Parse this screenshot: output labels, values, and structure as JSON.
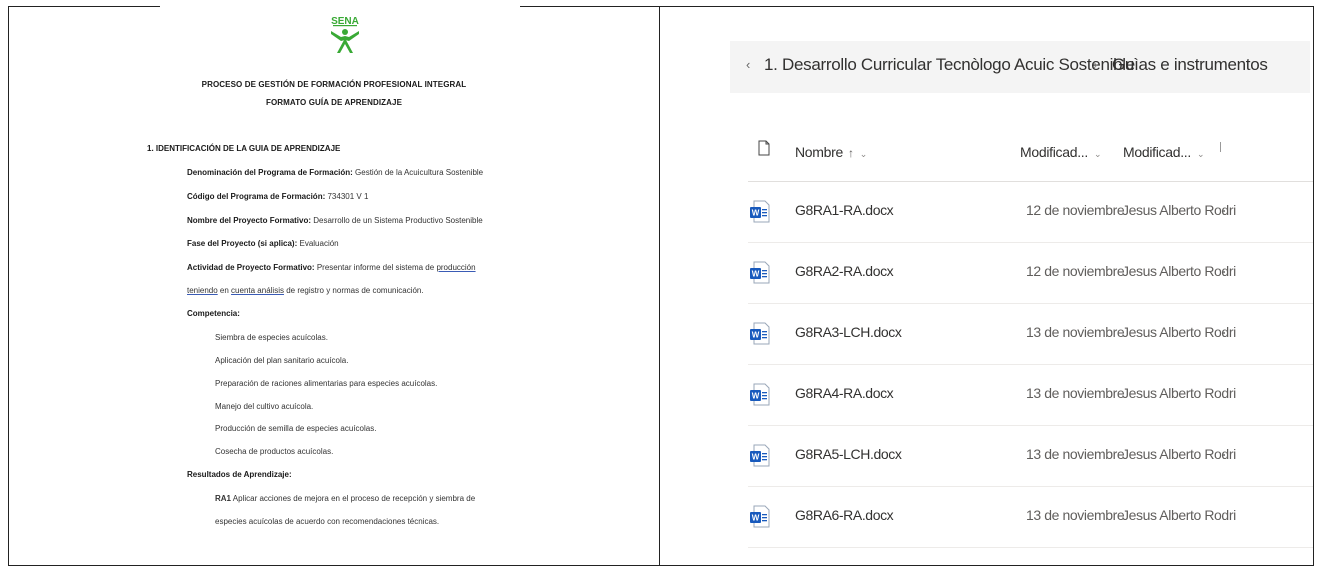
{
  "document": {
    "logo_text": "SENA",
    "header_line1": "PROCESO DE GESTIÓN DE FORMACIÓN PROFESIONAL INTEGRAL",
    "header_line2": "FORMATO GUÍA DE APRENDIZAJE",
    "section_title": "1. IDENTIFICACIÓN DE LA GUIA DE APRENDIZAJE",
    "fields": {
      "denominacion_label": "Denominación del Programa de Formación:",
      "denominacion_value": " Gestión de la Acuicultura Sostenible",
      "codigo_label": "Código del Programa de Formación:",
      "codigo_value": " 734301 V 1",
      "proyecto_label": "Nombre del Proyecto Formativo:",
      "proyecto_value": " Desarrollo de un Sistema Productivo Sostenible",
      "fase_label": "Fase del Proyecto (si aplica):",
      "fase_value": " Evaluación",
      "actividad_label": "Actividad de Proyecto Formativo:",
      "actividad_value_a": " Presentar informe del sistema de ",
      "actividad_value_link": "producción",
      "actividad_line2_link1": "teniendo",
      "actividad_line2_mid": " en ",
      "actividad_line2_link2": "cuenta  análisis",
      "actividad_line2_end": " de registro y normas de comunicación.",
      "competencia_label": "Competencia:",
      "resultados_label": "Resultados de Aprendizaje:",
      "ra1_label": "RA1",
      "ra1_line1": " Aplicar acciones de mejora en el proceso de recepción y siembra de",
      "ra1_line2": "especies acuícolas de acuerdo con recomendaciones técnicas."
    },
    "competencias": [
      "Siembra de especies acuícolas.",
      "Aplicación del plan sanitario acuícola.",
      "Preparación de raciones alimentarias para especies acuícolas.",
      "Manejo del cultivo acuícola.",
      "Producción de semilla de especies acuícolas.",
      "Cosecha de productos acuícolas."
    ]
  },
  "files": {
    "breadcrumb_current": "1. Desarrollo Curricular Tecnòlogo Acuic Sostenible",
    "breadcrumb_next": "Guìas e instrumentos",
    "columns": {
      "name": "Nombre",
      "name_sort": "↑",
      "modified": "Modificad...",
      "modified_by": "Modificad..."
    },
    "rows": [
      {
        "name": "G8RA1-RA.docx",
        "modified": "12 de noviembre",
        "modified_by": "Jesus Alberto Rodri"
      },
      {
        "name": "G8RA2-RA.docx",
        "modified": "12 de noviembre",
        "modified_by": "Jesus Alberto Rodri"
      },
      {
        "name": "G8RA3-LCH.docx",
        "modified": "13 de noviembre",
        "modified_by": "Jesus Alberto Rodri"
      },
      {
        "name": "G8RA4-RA.docx",
        "modified": "13 de noviembre",
        "modified_by": "Jesus Alberto Rodri"
      },
      {
        "name": "G8RA5-LCH.docx",
        "modified": "13 de noviembre",
        "modified_by": "Jesus Alberto Rodri"
      },
      {
        "name": "G8RA6-RA.docx",
        "modified": "13 de noviembre",
        "modified_by": "Jesus Alberto Rodri"
      }
    ],
    "icon_color": "#185abd"
  },
  "colors": {
    "sena_green": "#39a935",
    "word_blue": "#185abd",
    "breadcrumb_bg": "#f4f4f4"
  }
}
